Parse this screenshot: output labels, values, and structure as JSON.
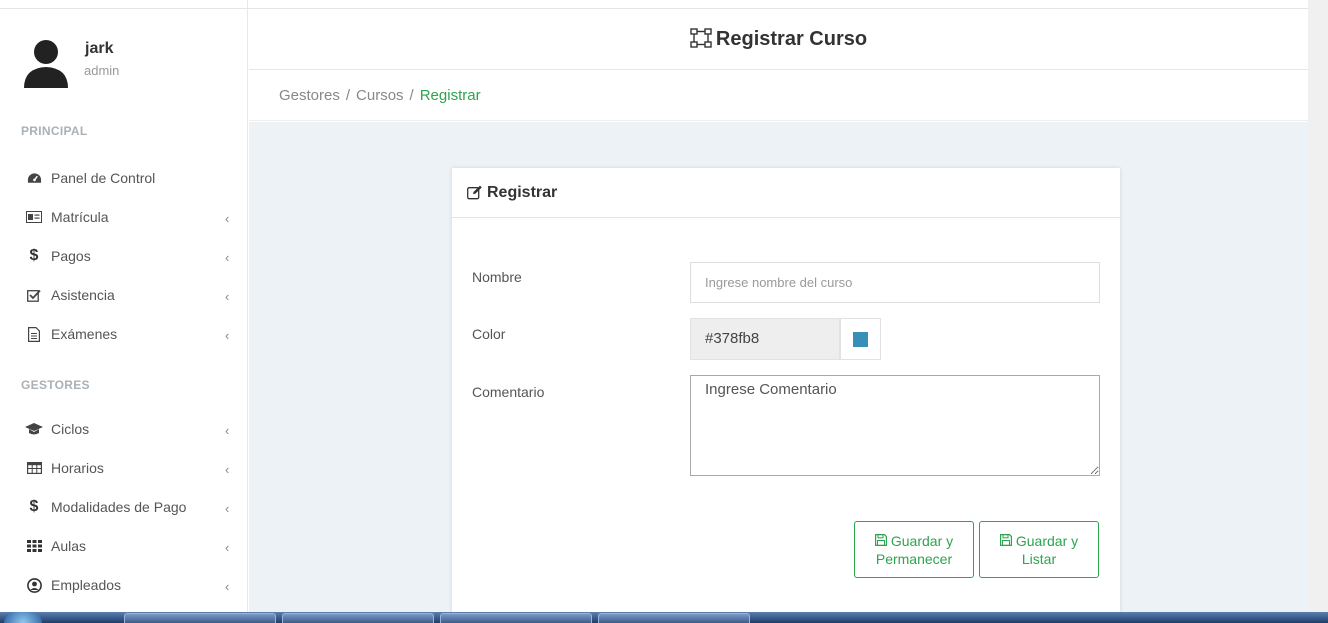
{
  "user": {
    "name": "jark",
    "role": "admin"
  },
  "sidebar": {
    "sections": [
      {
        "title": "PRINCIPAL"
      },
      {
        "title": "GESTORES"
      }
    ],
    "items": [
      {
        "label": "Panel de Control",
        "icon": "dashboard-icon",
        "has_submenu": false
      },
      {
        "label": "Matrícula",
        "icon": "id-card-icon",
        "has_submenu": true
      },
      {
        "label": "Pagos",
        "icon": "dollar-icon",
        "has_submenu": true
      },
      {
        "label": "Asistencia",
        "icon": "check-square-icon",
        "has_submenu": true
      },
      {
        "label": "Exámenes",
        "icon": "document-icon",
        "has_submenu": true
      },
      {
        "label": "Ciclos",
        "icon": "graduation-cap-icon",
        "has_submenu": true
      },
      {
        "label": "Horarios",
        "icon": "table-icon",
        "has_submenu": true
      },
      {
        "label": "Modalidades de Pago",
        "icon": "dollar-icon",
        "has_submenu": true
      },
      {
        "label": "Aulas",
        "icon": "grid-icon",
        "has_submenu": true
      },
      {
        "label": "Empleados",
        "icon": "user-circle-icon",
        "has_submenu": true
      }
    ],
    "chevron": "‹"
  },
  "header": {
    "title": "Registrar Curso"
  },
  "breadcrumb": {
    "items": [
      "Gestores",
      "Cursos",
      "Registrar"
    ],
    "separator": "/"
  },
  "card": {
    "title": "Registrar",
    "form": {
      "name_label": "Nombre",
      "name_placeholder": "Ingrese nombre del curso",
      "color_label": "Color",
      "color_value": "#378fb8",
      "comment_label": "Comentario",
      "comment_placeholder": "Ingrese Comentario"
    },
    "buttons": {
      "save_stay_line1": "Guardar y",
      "save_stay_line2": "Permanecer",
      "save_list_line1": "Guardar y",
      "save_list_line2": "Listar"
    }
  },
  "colors": {
    "accent": "#2da44e",
    "swatch": "#378fb8",
    "content_bg": "#ecf2f5"
  }
}
